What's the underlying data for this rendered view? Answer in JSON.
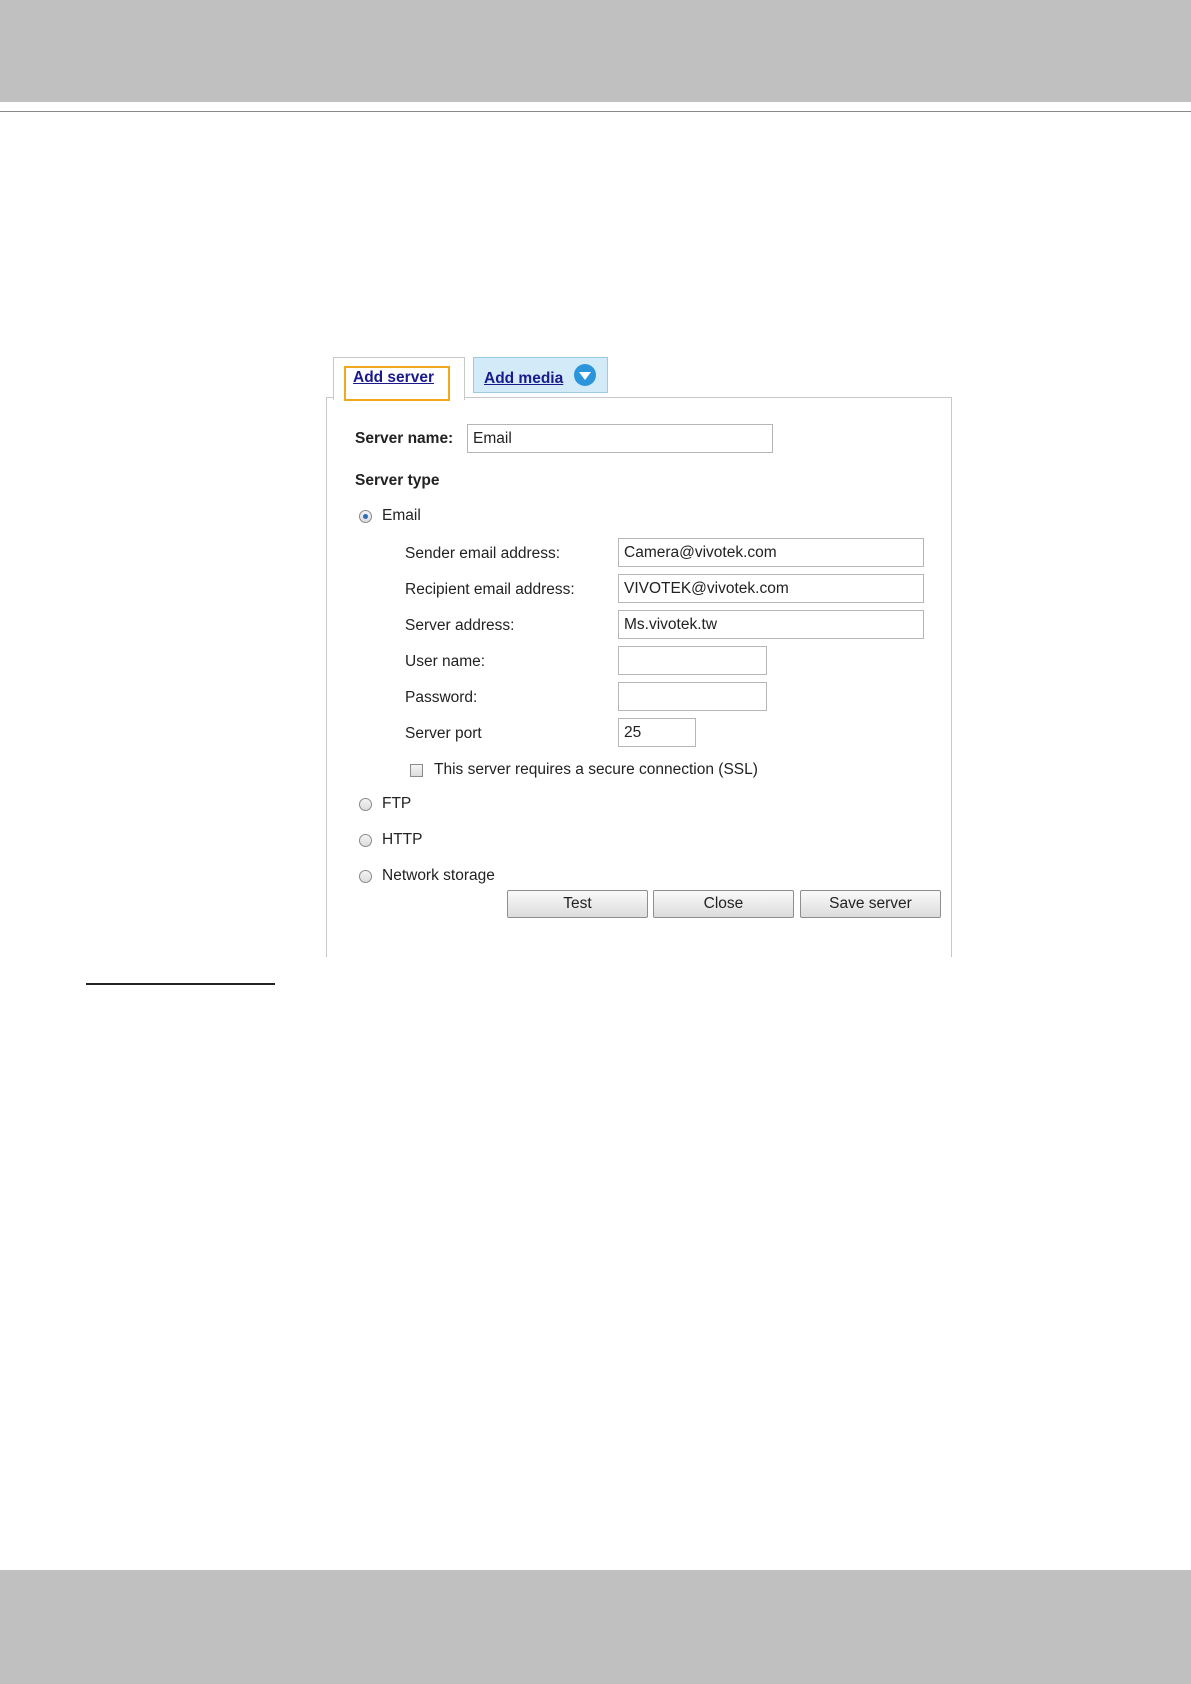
{
  "tabs": {
    "add_server": "Add server",
    "add_media": "Add media"
  },
  "form": {
    "server_name_label": "Server name:",
    "server_name_value": "Email",
    "server_type_label": "Server type",
    "types": {
      "email": "Email",
      "ftp": "FTP",
      "http": "HTTP",
      "network_storage": "Network storage"
    },
    "selected_type": "Email",
    "email": {
      "sender_label": "Sender email address:",
      "sender_value": "Camera@vivotek.com",
      "recipient_label": "Recipient email address:",
      "recipient_value": "VIVOTEK@vivotek.com",
      "server_address_label": "Server address:",
      "server_address_value": "Ms.vivotek.tw",
      "user_name_label": "User name:",
      "user_name_value": "",
      "password_label": "Password:",
      "password_value": "",
      "server_port_label": "Server port",
      "server_port_value": "25",
      "ssl_label": "This server requires a secure connection (SSL)",
      "ssl_checked": false
    }
  },
  "buttons": {
    "test": "Test",
    "close": "Close",
    "save": "Save server"
  },
  "colors": {
    "band": "#c0c0c0",
    "tab_highlight": "#f0a81e",
    "tab_media_bg": "#d3eaf8",
    "link": "#1a1a8c",
    "dropdown_icon": "#2b95dc"
  }
}
